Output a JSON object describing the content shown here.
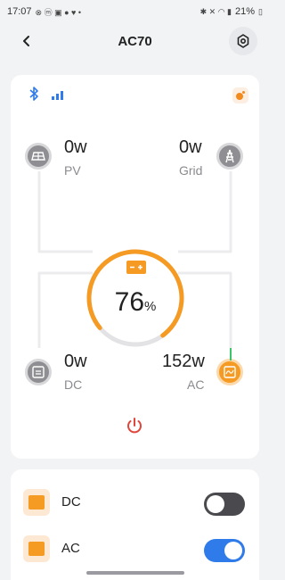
{
  "status_bar": {
    "time": "17:07",
    "battery": "21%"
  },
  "header": {
    "title": "AC70"
  },
  "power_card": {
    "pv": {
      "value": "0w",
      "label": "PV"
    },
    "grid": {
      "value": "0w",
      "label": "Grid"
    },
    "dc": {
      "value": "0w",
      "label": "DC"
    },
    "ac": {
      "value": "152w",
      "label": "AC"
    },
    "battery": {
      "percent": "76",
      "unit": "%",
      "level": 0.76
    }
  },
  "outputs": [
    {
      "label": "DC",
      "enabled": false
    },
    {
      "label": "AC",
      "enabled": true
    }
  ],
  "colors": {
    "accent": "#f59a23",
    "toggle_on": "#2f7bea",
    "power_button": "#e0463b",
    "bluetooth": "#2f7bea"
  }
}
